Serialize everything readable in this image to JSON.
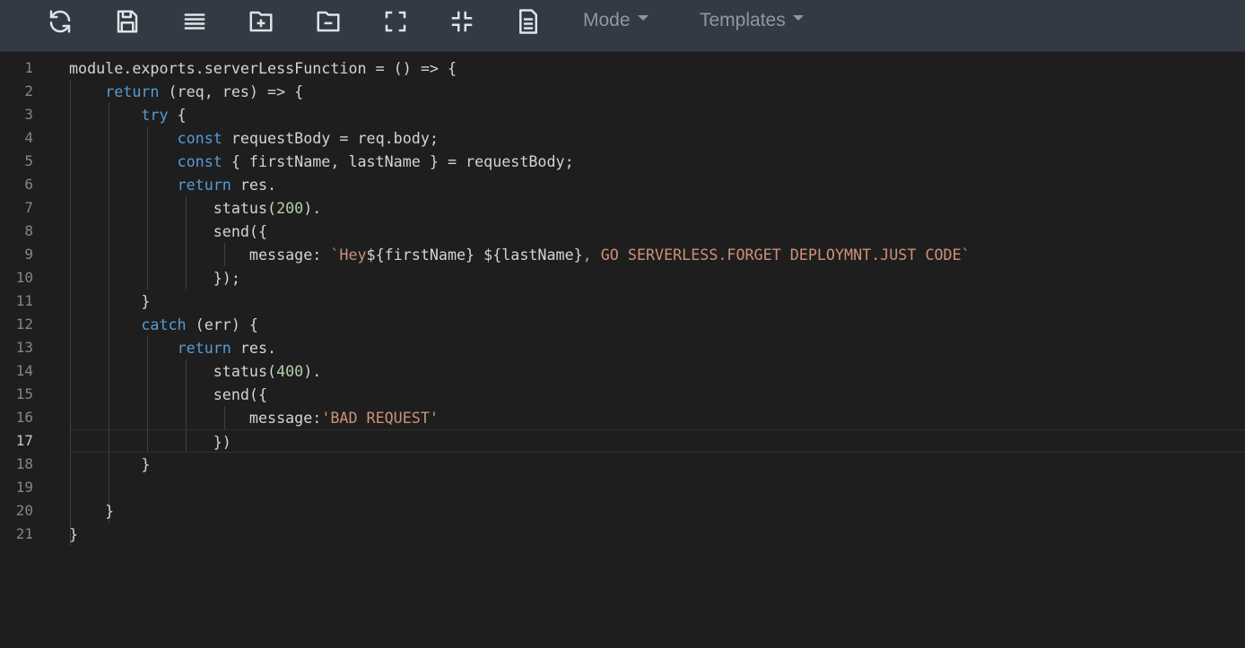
{
  "toolbar": {
    "buttons": [
      {
        "name": "refresh-icon",
        "label": "Refresh"
      },
      {
        "name": "save-icon",
        "label": "Save"
      },
      {
        "name": "format-icon",
        "label": "Format"
      },
      {
        "name": "expand-all-icon",
        "label": "Expand"
      },
      {
        "name": "collapse-all-icon",
        "label": "Collapse"
      },
      {
        "name": "fullscreen-icon",
        "label": "Fullscreen"
      },
      {
        "name": "exit-fullscreen-icon",
        "label": "Exit fullscreen"
      },
      {
        "name": "document-icon",
        "label": "Document"
      }
    ],
    "mode_label": "Mode",
    "templates_label": "Templates"
  },
  "editor": {
    "active_line": 17,
    "lines": [
      [
        [
          "module.exports.serverLessFunction = () => {",
          "plain"
        ]
      ],
      [
        [
          "    ",
          "plain"
        ],
        [
          "return",
          "kw"
        ],
        [
          " (req, res) => {",
          "plain"
        ]
      ],
      [
        [
          "        ",
          "plain"
        ],
        [
          "try",
          "kw"
        ],
        [
          " {",
          "plain"
        ]
      ],
      [
        [
          "            ",
          "plain"
        ],
        [
          "const",
          "kw"
        ],
        [
          " requestBody = req.body;",
          "plain"
        ]
      ],
      [
        [
          "            ",
          "plain"
        ],
        [
          "const",
          "kw"
        ],
        [
          " { firstName, lastName } = requestBody;",
          "plain"
        ]
      ],
      [
        [
          "            ",
          "plain"
        ],
        [
          "return",
          "kw"
        ],
        [
          " res.",
          "plain"
        ]
      ],
      [
        [
          "                status(",
          "plain"
        ],
        [
          "200",
          "num"
        ],
        [
          ").",
          "plain"
        ]
      ],
      [
        [
          "                send({",
          "plain"
        ]
      ],
      [
        [
          "                    message: ",
          "plain"
        ],
        [
          "`Hey",
          "str"
        ],
        [
          "${firstName} ${lastName}",
          "plain"
        ],
        [
          ", GO SERVERLESS.FORGET DEPLOYMNT.JUST CODE`",
          "str"
        ]
      ],
      [
        [
          "                });",
          "plain"
        ]
      ],
      [
        [
          "        }",
          "plain"
        ]
      ],
      [
        [
          "        ",
          "plain"
        ],
        [
          "catch",
          "kw"
        ],
        [
          " (err) {",
          "plain"
        ]
      ],
      [
        [
          "            ",
          "plain"
        ],
        [
          "return",
          "kw"
        ],
        [
          " res.",
          "plain"
        ]
      ],
      [
        [
          "                status(",
          "plain"
        ],
        [
          "400",
          "num"
        ],
        [
          ").",
          "plain"
        ]
      ],
      [
        [
          "                send({",
          "plain"
        ]
      ],
      [
        [
          "                    message:",
          "plain"
        ],
        [
          "'BAD REQUEST'",
          "str"
        ]
      ],
      [
        [
          "                })",
          "plain"
        ]
      ],
      [
        [
          "        }",
          "plain"
        ]
      ],
      [
        [
          "",
          "plain"
        ]
      ],
      [
        [
          "    }",
          "plain"
        ]
      ],
      [
        [
          "}",
          "plain"
        ]
      ]
    ]
  },
  "colors": {
    "toolbar_bg": "#333a43",
    "editor_bg": "#1e1e1e",
    "keyword": "#569cd6",
    "number": "#b5cea8",
    "string": "#ce9178",
    "text": "#d4d4d4"
  }
}
